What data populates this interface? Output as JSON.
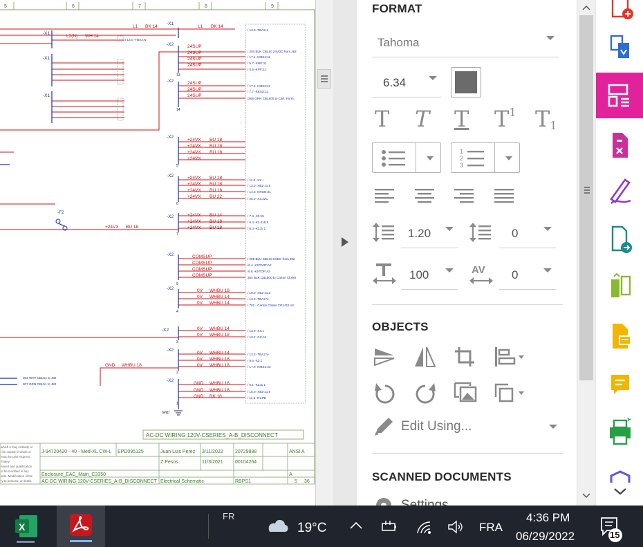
{
  "doc": {
    "ruler_numbers": [
      "5",
      "6",
      "7",
      "8",
      "9"
    ],
    "wire_top": [
      "L1",
      "BK 14",
      "L1",
      "BK 14"
    ],
    "wire_l2": "L2(N)",
    "wire_wh14": "WH 14",
    "terminal_labels": [
      "-X1",
      "-X1",
      "-X1",
      "-X1",
      "-X2",
      "-X2",
      "-X2",
      "-X2",
      "-X2",
      "-X2",
      "-X2",
      "-X2",
      "-X2",
      "-X2",
      "-X2"
    ],
    "supply_24sup": [
      "24SUP",
      "24SUP",
      "24SUP",
      "24SUP",
      "24SUP",
      "24SUP",
      "24SUP"
    ],
    "supply_24vx": [
      "+24VX",
      "+24VX",
      "+24VX",
      "+24VX"
    ],
    "wire_24vx_bu18": [
      "BU 18",
      "BU 18",
      "BU 18",
      "BU 18"
    ],
    "supply_24vx_2": [
      "+24VX",
      "+24VX",
      "+24VX",
      "+24VX"
    ],
    "wire_24vx_2": [
      "BU 18",
      "BU 18",
      "BU 18",
      "BU 22"
    ],
    "supply_24vx_3": [
      "+24VX",
      "+24VX",
      "+24VX"
    ],
    "wire_24vx_3": [
      "BU 14",
      "BU 18",
      "BU 18"
    ],
    "fuse_label": "-F2",
    "wire_24vx_main": "+24VX",
    "wire_24vx_main_bu": "BU 18",
    "com_sup": [
      "COMSUP",
      "COMSUP",
      "COMSUP",
      "COMSUP"
    ],
    "zero_v": [
      "0V",
      "0V",
      "0V"
    ],
    "wire_0v": [
      "WHBU 18",
      "WHBU 14",
      "WHBU 14"
    ],
    "zero_v_2": [
      "0V",
      "0V"
    ],
    "wire_0v_2": [
      "WHBU 14",
      "WHBU 18"
    ],
    "zero_v_3": [
      "0V",
      "0V",
      "0V"
    ],
    "wire_0v_3": [
      "WHBU 14",
      "WHBU 18",
      "WHBU 18"
    ],
    "gnd": [
      "GND",
      "GND",
      "GND"
    ],
    "wire_gnd": [
      "WHBU 18",
      "WHBU 18",
      "BK 18"
    ],
    "gnd_main": "GND",
    "gnd_main_wire": "WHBU 18",
    "gnd_symbol": "GND",
    "right_refs": [
      "/ 13.0 -TBA2:1",
      "/ 13.0 -TBA2:N",
      "/ 204 BLK CBL10 24VDC from J82",
      "/ 17.1 -KMS1:11",
      "/ 5.7 -KMF:11",
      "/ 6.5 -KPF:11",
      "/ 17.2 -KMS2:11",
      "/ 7.7 -KESS:11",
      "/306 GRN CBL800 to Cart. Form.",
      "/ 11.0 -X1:+",
      "/ 13.0 -XB2-J1:5",
      "/ 14.3 -KRUN:21",
      "/ 25.0 -X3:22C",
      "/ 7.4 -X3:15",
      "/ 6.4 -K2-J15:8",
      "/ 6.4 -K2J1:1",
      "/ 205 BLU CBL10 0VDC from J82",
      "/6.4 -KSTART:A2",
      "/6.6 -KSTOP:A2",
      "304 BLK CBL800 to Carton Closer",
      "/ 15.0 -XB2-J1:3",
      "/ 13.3 -TBA2:V-",
      "/ 702 - Carton Closer CR1411 A2",
      "/ 13.0 -X4:1",
      "/ 13.2 -C2:A2",
      "/ 13.3 -TBA2:V-",
      "/ 9.5 -X3:1",
      "/ 17.0 -KMS1:A2",
      "/ 6.1 -K2J1:1",
      "/ 15.0 -XB2-J1:6",
      "/ 11.0 -K1:PE"
    ],
    "left_refs": [
      "303 WHT CBL51 to J82",
      "307 GRN CBL51 to J82"
    ],
    "node_numbers": [
      "13",
      "14",
      "5",
      "6",
      "7",
      "8",
      "9",
      "15-18",
      "4",
      "3",
      "2",
      "1"
    ],
    "sheet_title": "AC-DC WIRING 120V-CSERIES_A-B_DISCONNECT",
    "title_block": {
      "project": "J-94720420 - 40 - Med-XL CW-L",
      "drawing_no": "EPD095125",
      "drawn_by": "Juan Luis Perez",
      "date1": "3/11/2022",
      "doc_no": "20729888",
      "rev_by": "Z.Pesos",
      "date2": "11/3/2021",
      "doc_no2": "00104264",
      "location": "Enclosure_EAC_Main_C3350",
      "sheet_name": "AC-DC WIRING 120V-CSERIES_A-B_DISCONNECT",
      "doc_type": "Electrical Schematic",
      "code": "RBPS1",
      "sheet": "5",
      "of": "36",
      "standard": "ANSI A",
      "revision": "A",
      "legal_lines": [
        "which it may embody or",
        "t be copied in whole or",
        "hout the prior express",
        "Tinkey.",
        "ement and qualification",
        "ot be modified in any",
        "ledo. Modification of the",
        "ry to persons, or death."
      ]
    }
  },
  "panel": {
    "format_title": "FORMAT",
    "font_name": "Tahoma",
    "font_size": "6.34",
    "text_color": "#6b6b6b",
    "line_spacing": "1.20",
    "para_spacing": "0",
    "scale": "100",
    "char_spacing": "0",
    "objects_title": "OBJECTS",
    "edit_using": "Edit Using...",
    "scanned_title": "SCANNED DOCUMENTS",
    "settings_label": "Settings"
  },
  "rail": {
    "active_color": "#e1229a",
    "tools": [
      "add-pdf-icon",
      "export-pdf-icon",
      "edit-pdf-icon",
      "redact-icon",
      "fill-sign-icon",
      "send-pdf-icon",
      "compare-icon",
      "comment-icon",
      "speech-icon",
      "print-production-icon",
      "protect-icon"
    ]
  },
  "taskbar": {
    "lang_small": "FR",
    "temperature": "19°C",
    "lang": "FRA",
    "time": "4:36 PM",
    "date": "06/29/2022",
    "notifications": "15"
  }
}
